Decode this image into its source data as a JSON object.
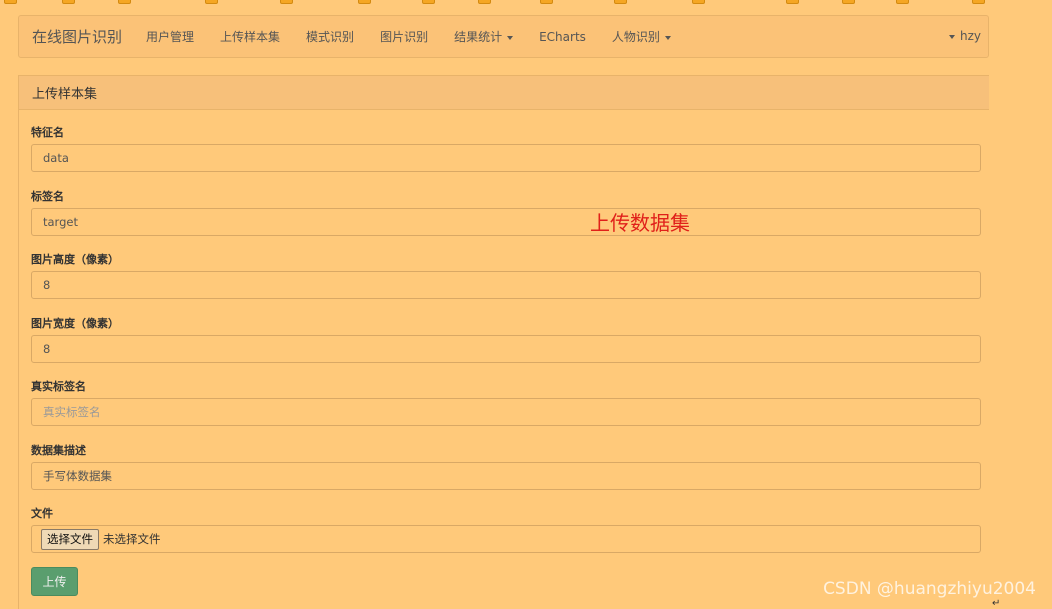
{
  "navbar": {
    "brand": "在线图片识别",
    "items": [
      {
        "label": "用户管理",
        "dropdown": false
      },
      {
        "label": "上传样本集",
        "dropdown": false
      },
      {
        "label": "模式识别",
        "dropdown": false
      },
      {
        "label": "图片识别",
        "dropdown": false
      },
      {
        "label": "结果统计",
        "dropdown": true
      },
      {
        "label": "ECharts",
        "dropdown": false
      },
      {
        "label": "人物识别",
        "dropdown": true
      }
    ],
    "user": "hzy"
  },
  "panel": {
    "title": "上传样本集"
  },
  "form": {
    "feature_name": {
      "label": "特征名",
      "value": "data"
    },
    "label_name": {
      "label": "标签名",
      "value": "target"
    },
    "image_height": {
      "label": "图片高度（像素）",
      "value": "8"
    },
    "image_width": {
      "label": "图片宽度（像素）",
      "value": "8"
    },
    "true_label": {
      "label": "真实标签名",
      "placeholder": "真实标签名"
    },
    "dataset_desc": {
      "label": "数据集描述",
      "value": "手写体数据集"
    },
    "file": {
      "label": "文件",
      "button": "选择文件",
      "status": "未选择文件"
    },
    "submit_label": "上传"
  },
  "annotation": "上传数据集",
  "watermark": "CSDN @huangzhiyu2004",
  "colors": {
    "page_bg": "#ffc97a",
    "submit_bg": "#5a9e6e",
    "annotation": "#e0201a"
  }
}
